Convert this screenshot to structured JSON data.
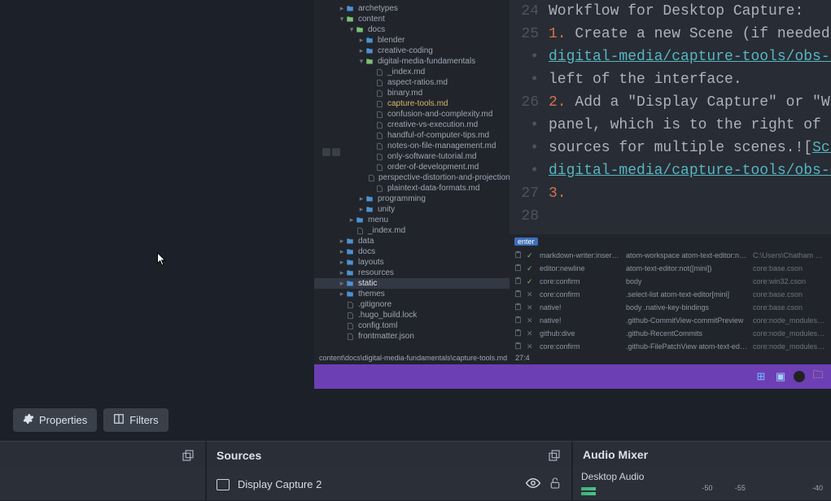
{
  "editor": {
    "tree": {
      "items": [
        {
          "indent": 1,
          "type": "folder",
          "open": false,
          "label": "archetypes"
        },
        {
          "indent": 1,
          "type": "folder",
          "open": true,
          "label": "content"
        },
        {
          "indent": 2,
          "type": "folder",
          "open": true,
          "label": "docs"
        },
        {
          "indent": 3,
          "type": "folder",
          "open": false,
          "label": "blender"
        },
        {
          "indent": 3,
          "type": "folder",
          "open": false,
          "label": "creative-coding"
        },
        {
          "indent": 3,
          "type": "folder",
          "open": true,
          "label": "digital-media-fundamentals"
        },
        {
          "indent": 4,
          "type": "file",
          "label": "_index.md"
        },
        {
          "indent": 4,
          "type": "file",
          "label": "aspect-ratios.md"
        },
        {
          "indent": 4,
          "type": "file",
          "label": "binary.md"
        },
        {
          "indent": 4,
          "type": "file",
          "label": "capture-tools.md",
          "active": true
        },
        {
          "indent": 4,
          "type": "file",
          "label": "confusion-and-complexity.md"
        },
        {
          "indent": 4,
          "type": "file",
          "label": "creative-vs-execution.md"
        },
        {
          "indent": 4,
          "type": "file",
          "label": "handful-of-computer-tips.md"
        },
        {
          "indent": 4,
          "type": "file",
          "label": "notes-on-file-management.md"
        },
        {
          "indent": 4,
          "type": "file",
          "label": "only-software-tutorial.md"
        },
        {
          "indent": 4,
          "type": "file",
          "label": "order-of-development.md"
        },
        {
          "indent": 4,
          "type": "file",
          "label": "perspective-distortion-and-projections.md"
        },
        {
          "indent": 4,
          "type": "file",
          "label": "plaintext-data-formats.md"
        },
        {
          "indent": 3,
          "type": "folder",
          "open": false,
          "label": "programming"
        },
        {
          "indent": 3,
          "type": "folder",
          "open": false,
          "label": "unity"
        },
        {
          "indent": 2,
          "type": "folder",
          "open": false,
          "label": "menu"
        },
        {
          "indent": 2,
          "type": "file",
          "label": "_index.md"
        },
        {
          "indent": 1,
          "type": "folder",
          "open": false,
          "label": "data"
        },
        {
          "indent": 1,
          "type": "folder",
          "open": false,
          "label": "docs"
        },
        {
          "indent": 1,
          "type": "folder",
          "open": false,
          "label": "layouts"
        },
        {
          "indent": 1,
          "type": "folder",
          "open": false,
          "label": "resources"
        },
        {
          "indent": 1,
          "type": "folder",
          "open": false,
          "label": "static",
          "row_active": true
        },
        {
          "indent": 1,
          "type": "folder",
          "open": false,
          "label": "themes"
        },
        {
          "indent": 1,
          "type": "file",
          "label": ".gitignore"
        },
        {
          "indent": 1,
          "type": "file",
          "label": ".hugo_build.lock"
        },
        {
          "indent": 1,
          "type": "file",
          "label": "config.toml"
        },
        {
          "indent": 1,
          "type": "file",
          "label": "frontmatter.json"
        }
      ]
    },
    "code_lines": [
      {
        "gutter": "24",
        "segs": [
          {
            "t": "Workflow for Desktop Capture:",
            "cls": ""
          }
        ]
      },
      {
        "gutter": "25",
        "segs": [
          {
            "t": "1.",
            "cls": "kw-num"
          },
          {
            "t": " Create a new Scene (if needed)",
            "cls": ""
          }
        ]
      },
      {
        "gutter": "•",
        "segs": [
          {
            "t": "digital-media/capture-tools/obs-n",
            "cls": "kw-link"
          }
        ]
      },
      {
        "gutter": "•",
        "segs": [
          {
            "t": "left of the interface.",
            "cls": ""
          }
        ]
      },
      {
        "gutter": "26",
        "segs": [
          {
            "t": "2.",
            "cls": "kw-num"
          },
          {
            "t": " Add a \"Display Capture\" or \"Wi",
            "cls": ""
          }
        ]
      },
      {
        "gutter": "•",
        "segs": [
          {
            "t": "panel, which is to the right of t",
            "cls": ""
          }
        ]
      },
      {
        "gutter": "•",
        "segs": [
          {
            "t": "sources for multiple scenes.![",
            "cls": ""
          },
          {
            "t": "Scr",
            "cls": "kw-link"
          }
        ]
      },
      {
        "gutter": "•",
        "segs": [
          {
            "t": "digital-media/capture-tools/obs-c",
            "cls": "kw-link"
          }
        ]
      },
      {
        "gutter": "27",
        "segs": [
          {
            "t": "3.",
            "cls": "kw-num"
          }
        ]
      },
      {
        "gutter": "28",
        "segs": [
          {
            "t": "",
            "cls": ""
          }
        ]
      }
    ],
    "keybinds": {
      "badge": "enter",
      "rows": [
        {
          "ok": true,
          "c1": "markdown-writer:insert-new-line",
          "c2": "atom-workspace atom-text-editor:not([mini])",
          "c3": "C:\\Users\\Chatham University\\.atom\\pack"
        },
        {
          "ok": true,
          "c1": "editor:newline",
          "c2": "atom-text-editor:not([mini])",
          "c3": "core:base.cson"
        },
        {
          "ok": true,
          "c1": "core:confirm",
          "c2": "body",
          "c3": "core:win32.cson"
        },
        {
          "ok": false,
          "c1": "core:confirm",
          "c2": ".select-list atom-text-editor[mini]",
          "c3": "core:base.cson"
        },
        {
          "ok": false,
          "c1": "native!",
          "c2": "body .native-key-bindings",
          "c3": "core:base.cson"
        },
        {
          "ok": false,
          "c1": "native!",
          "c2": ".github-CommitView-commitPreview",
          "c3": "core:node_modules\\github\\keymaps\\git"
        },
        {
          "ok": false,
          "c1": "github:dive",
          "c2": ".github-RecentCommits",
          "c3": "core:node_modules\\github\\keymaps\\git"
        },
        {
          "ok": false,
          "c1": "core:confirm",
          "c2": ".github-FilePatchView atom-text-editor:not([mini])",
          "c3": "core:node_modules\\github\\keymaps\\git"
        }
      ]
    },
    "statusbar": {
      "path": "content\\docs\\digital-media-fundamentals\\capture-tools.md",
      "col": "27:4"
    }
  },
  "obs": {
    "toolbar": {
      "properties": "Properties",
      "filters": "Filters"
    },
    "panels": {
      "scenes": {
        "title": ""
      },
      "sources": {
        "title": "Sources",
        "items": [
          {
            "label": "Display Capture 2"
          }
        ]
      },
      "mixer": {
        "title": "Audio Mixer",
        "track": "Desktop Audio",
        "ticks": [
          "-50",
          "-55",
          "",
          "",
          "-40"
        ]
      }
    }
  }
}
